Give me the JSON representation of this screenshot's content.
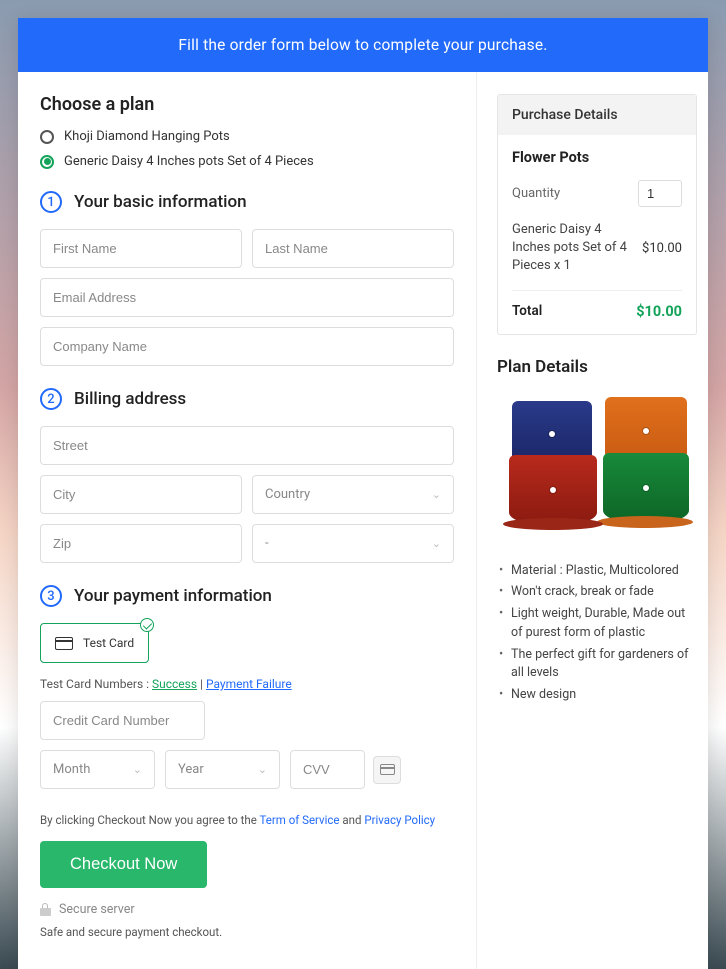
{
  "header": {
    "banner": "Fill the order form below to complete your purchase."
  },
  "plan": {
    "heading": "Choose a plan",
    "options": [
      {
        "label": "Khoji Diamond Hanging Pots",
        "selected": false
      },
      {
        "label": "Generic Daisy 4 Inches pots Set of 4 Pieces",
        "selected": true
      }
    ]
  },
  "section1": {
    "number": "1",
    "title": "Your basic information",
    "first_name_placeholder": "First Name",
    "last_name_placeholder": "Last Name",
    "email_placeholder": "Email Address",
    "company_placeholder": "Company Name"
  },
  "section2": {
    "number": "2",
    "title": "Billing address",
    "street_placeholder": "Street",
    "city_placeholder": "City",
    "country_placeholder": "Country",
    "zip_placeholder": "Zip",
    "state_placeholder": "-"
  },
  "section3": {
    "number": "3",
    "title": "Your payment information",
    "card_option": "Test  Card",
    "test_prefix": "Test Card Numbers : ",
    "test_success": "Success",
    "test_sep": " | ",
    "test_failure": "Payment Failure",
    "cc_placeholder": "Credit Card Number",
    "month_placeholder": "Month",
    "year_placeholder": "Year",
    "cvv_placeholder": "CVV"
  },
  "agree": {
    "prefix": "By clicking Checkout Now you agree to the ",
    "tos": "Term of Service",
    "mid": " and ",
    "pp": "Privacy Policy"
  },
  "checkout_button": "Checkout Now",
  "secure": {
    "line": "Secure server",
    "sub": "Safe and secure payment checkout."
  },
  "purchase": {
    "heading": "Purchase Details",
    "title": "Flower Pots",
    "quantity_label": "Quantity",
    "quantity_value": "1",
    "product_line": "Generic Daisy 4 Inches pots Set of 4 Pieces x 1",
    "product_price": "$10.00",
    "total_label": "Total",
    "total_value": "$10.00"
  },
  "plan_details": {
    "heading": "Plan Details",
    "bullets": [
      "Material : Plastic, Multicolored",
      "Won't crack, break or fade",
      "Light weight, Durable, Made out of purest form of plastic",
      "The perfect gift for gardeners of all levels",
      "New design"
    ]
  }
}
